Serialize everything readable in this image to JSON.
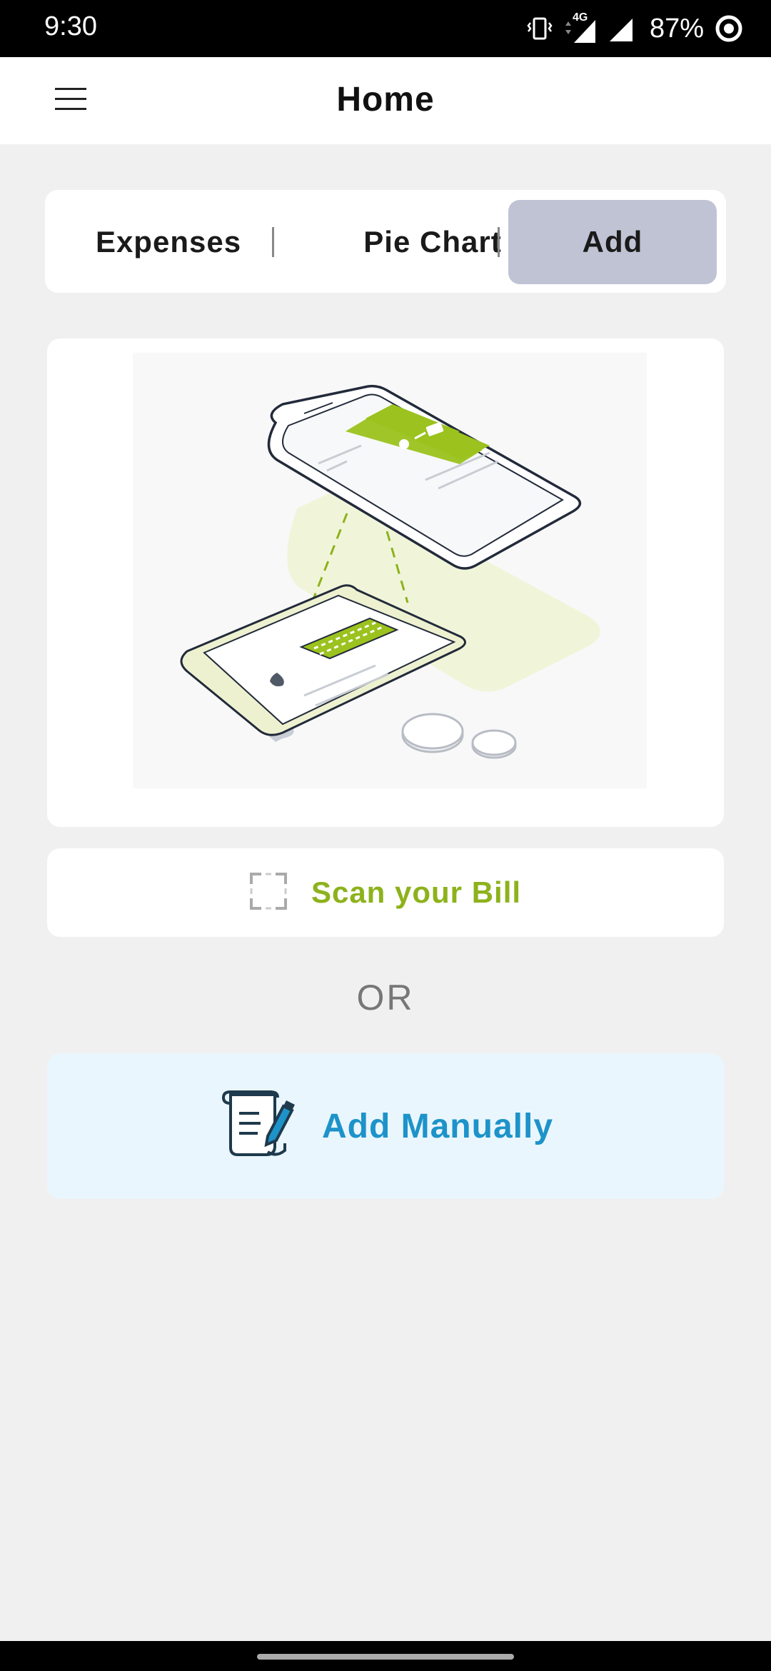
{
  "status_bar": {
    "time": "9:30",
    "network": "4G",
    "battery": "87%"
  },
  "app_bar": {
    "title": "Home",
    "menu_icon": "hamburger-menu-icon"
  },
  "tabs": [
    {
      "label": "Expenses",
      "selected": false
    },
    {
      "label": "Pie Chart",
      "selected": false
    },
    {
      "label": "Add",
      "selected": true
    }
  ],
  "scan": {
    "label": "Scan your Bill",
    "icon": "scan-frame-icon"
  },
  "separator": {
    "label": "OR"
  },
  "manual": {
    "label": "Add Manually",
    "icon": "document-pen-icon"
  },
  "colors": {
    "accent_green": "#8db21c",
    "accent_blue": "#1d93c9",
    "selected_tab": "#bfc3d4",
    "manual_bg": "#eaf6fd"
  }
}
